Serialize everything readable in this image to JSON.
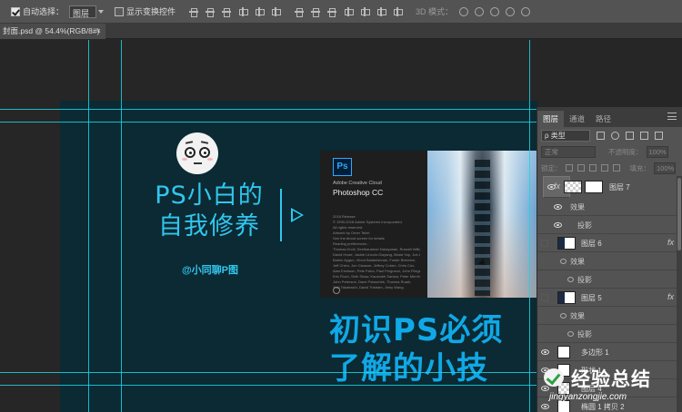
{
  "options_bar": {
    "auto_select_label": "自动选择：",
    "auto_select_value": "图层",
    "show_transform_label": "显示变换控件",
    "mode_3d_label": "3D 模式："
  },
  "document_tab": {
    "title": "封面.psd @ 54.4%(RGB/8#)",
    "close": "×"
  },
  "canvas": {
    "title_line1": "PS小白的",
    "title_line2": "自我修养",
    "handle": "@小同聊P图",
    "big_title_line1": "初识PS必须",
    "big_title_line2": "了解的小技",
    "splash": {
      "logo": "Ps",
      "brand": "Adobe Creative Cloud",
      "product": "Photoshop CC",
      "small_lines": [
        "2018 Release",
        "© 1990-2018 Adobe Systems Incorporated.",
        "All rights reserved.",
        "Artwork by Omer Tekel",
        "See the About screen for details",
        "Reading preferences...",
        "Thomas Knoll, Seetharaman Narayanan, Russell Williams,",
        "David Howe, Jackie Lincoln-Owyang, Maria Yap, Joe Ault,",
        "Barkin Aygun, Vinod Balakrishnan, Foster Brereton,",
        "Jeff Chien, Jon Clauson, Jeffrey Cohen, Chris Cox,",
        "Alan Erickson, Pete Falco, Paul Ferguson, John Fitzgerald,",
        "Eric Floch, Seth Shaw, Kaustubh Sankar, Peter Merrill,",
        "John Peterson, Dave Polaschek, Thomas Ruark,",
        "Yuki Takahashi, David Tristram, Jinny Wang"
      ]
    }
  },
  "layers_panel": {
    "tabs": [
      "图层",
      "通道",
      "路径"
    ],
    "kind_filter": "ρ 类型",
    "blend_mode": "正常",
    "opacity_label": "不透明度：",
    "opacity_value": "100%",
    "lock_label": "锁定：",
    "fill_label": "填充：",
    "fill_value": "100%",
    "layers": [
      {
        "name": "图层 7",
        "fx": "fx",
        "effect": "效果",
        "sub": "投影"
      },
      {
        "name": "图层 6",
        "fx": "fx",
        "effect": "效果",
        "sub": "投影"
      },
      {
        "name": "图层 5",
        "fx": "fx",
        "effect": "效果",
        "sub": "投影"
      },
      {
        "name": "多边形 1"
      },
      {
        "name": "形状 1"
      },
      {
        "name": "图层 4"
      },
      {
        "name": "椭圆 1 拷贝 2"
      }
    ]
  },
  "watermark": {
    "text": "经验总结",
    "url": "jingyanzongjie.com"
  },
  "colors": {
    "accent_cyan": "#31c6ef",
    "guide": "#1ad4e6",
    "artboard_bg": "#0b2a33",
    "big_title": "#10a8e6",
    "panel_bg": "#535353"
  }
}
